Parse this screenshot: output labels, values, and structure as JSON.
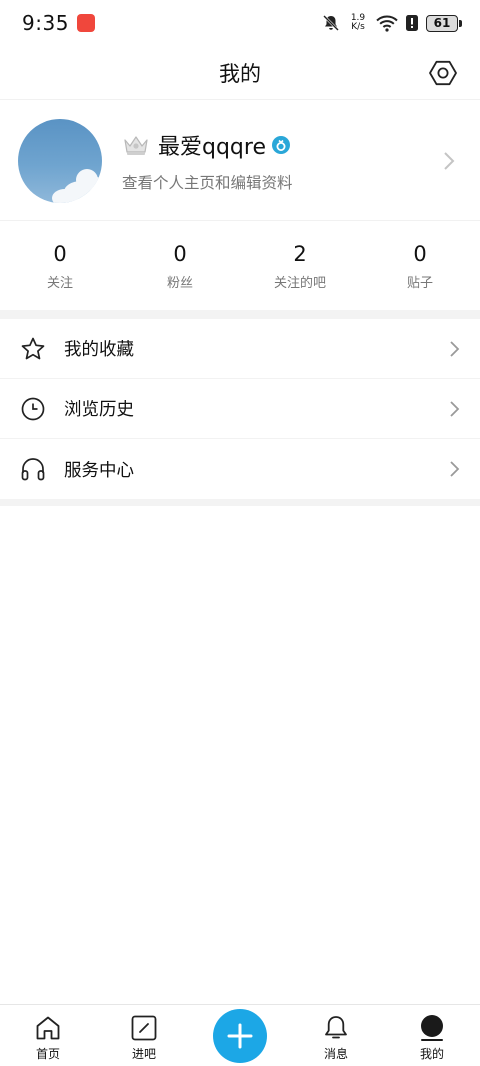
{
  "status_bar": {
    "time": "9:35",
    "speed_value": "1.9",
    "speed_unit": "K/s",
    "battery": "61"
  },
  "header": {
    "title": "我的",
    "settings_icon": "settings-hexagon-icon"
  },
  "profile": {
    "username": "最爱qqqre",
    "subtitle": "查看个人主页和编辑资料"
  },
  "stats": [
    {
      "value": "0",
      "label": "关注"
    },
    {
      "value": "0",
      "label": "粉丝"
    },
    {
      "value": "2",
      "label": "关注的吧"
    },
    {
      "value": "0",
      "label": "贴子"
    }
  ],
  "menu": [
    {
      "label": "我的收藏",
      "icon": "star-icon"
    },
    {
      "label": "浏览历史",
      "icon": "clock-icon"
    },
    {
      "label": "服务中心",
      "icon": "headphones-icon"
    }
  ],
  "bottom_nav": [
    {
      "label": "首页",
      "icon": "home-icon"
    },
    {
      "label": "进吧",
      "icon": "edit-square-icon"
    },
    {
      "label": "",
      "icon": "plus-icon"
    },
    {
      "label": "消息",
      "icon": "bell-icon"
    },
    {
      "label": "我的",
      "icon": "profile-icon"
    }
  ],
  "colors": {
    "accent": "#1ca7e6",
    "text": "#111111",
    "secondary": "#777777"
  }
}
